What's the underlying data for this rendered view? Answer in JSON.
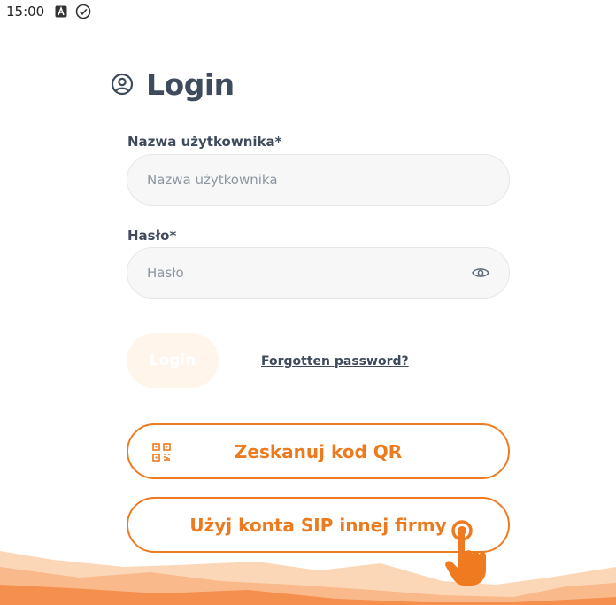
{
  "status_bar": {
    "time": "15:00",
    "icons": [
      "a-box-icon",
      "check-circle-icon"
    ]
  },
  "header": {
    "icon": "user-circle-icon",
    "title": "Login"
  },
  "form": {
    "username": {
      "label": "Nazwa użytkownika*",
      "placeholder": "Nazwa użytkownika",
      "value": ""
    },
    "password": {
      "label": "Hasło*",
      "placeholder": "Hasło",
      "value": "",
      "toggle_icon": "eye-icon"
    },
    "login_button": "Login",
    "forgot_password": "Forgotten password?"
  },
  "actions": {
    "scan_qr": {
      "label": "Zeskanuj kod QR",
      "icon": "qr-code-icon"
    },
    "sip_account": {
      "label": "Użyj konta SIP innej firmy"
    }
  },
  "colors": {
    "accent": "#f07a1f",
    "text": "#3d4b5c",
    "field_bg": "#f7f7f7",
    "login_button_disabled": "#fff5ea"
  }
}
